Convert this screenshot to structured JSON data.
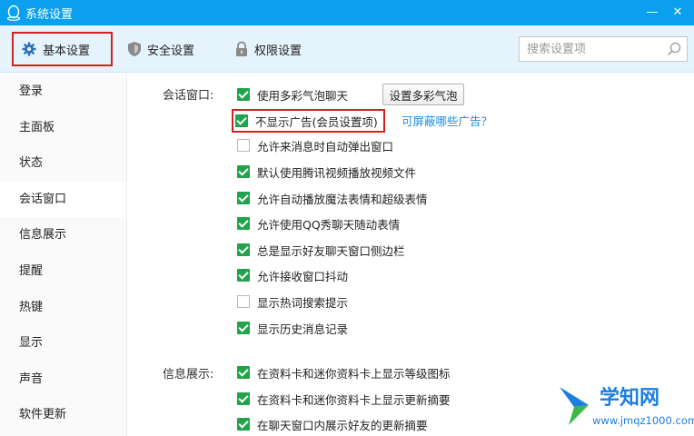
{
  "window": {
    "title": "系统设置",
    "minimize": "—",
    "close": "✕"
  },
  "tabs": [
    {
      "label": "基本设置",
      "icon": "gear-icon"
    },
    {
      "label": "安全设置",
      "icon": "shield-icon"
    },
    {
      "label": "权限设置",
      "icon": "lock-icon"
    }
  ],
  "search": {
    "placeholder": "搜索设置项",
    "icon": "search-icon"
  },
  "sidebar": {
    "items": [
      "登录",
      "主面板",
      "状态",
      "会话窗口",
      "信息展示",
      "提醒",
      "热键",
      "显示",
      "声音",
      "软件更新"
    ],
    "active": "会话窗口"
  },
  "chat_window": {
    "label": "会话窗口:",
    "bubble_button": "设置多彩气泡",
    "ads_link": "可屏蔽哪些广告？",
    "options": [
      {
        "label": "使用多彩气泡聊天",
        "checked": true
      },
      {
        "label": "不显示广告(会员设置项)",
        "checked": true
      },
      {
        "label": "允许来消息时自动弹出窗口",
        "checked": false
      },
      {
        "label": "默认使用腾讯视频播放视频文件",
        "checked": true
      },
      {
        "label": "允许自动播放魔法表情和超级表情",
        "checked": true
      },
      {
        "label": "允许使用QQ秀聊天随动表情",
        "checked": true
      },
      {
        "label": "总是显示好友聊天窗口侧边栏",
        "checked": true
      },
      {
        "label": "允许接收窗口抖动",
        "checked": true
      },
      {
        "label": "显示热词搜索提示",
        "checked": false
      },
      {
        "label": "显示历史消息记录",
        "checked": true
      }
    ]
  },
  "info_display": {
    "label": "信息展示:",
    "options": [
      {
        "label": "在资料卡和迷你资料卡上显示等级图标",
        "checked": true
      },
      {
        "label": "在资料卡和迷你资料卡上显示更新摘要",
        "checked": true
      },
      {
        "label": "在聊天窗口内展示好友的更新摘要",
        "checked": true
      }
    ]
  },
  "watermark": {
    "text": "学知网",
    "url": "www.jmqz1000.com"
  },
  "colors": {
    "titlebar": "#0aa0ee",
    "tabbar": "#e5f3fc",
    "checkbox": "#20a34a",
    "highlight": "#d42020",
    "link": "#1a8de0"
  }
}
